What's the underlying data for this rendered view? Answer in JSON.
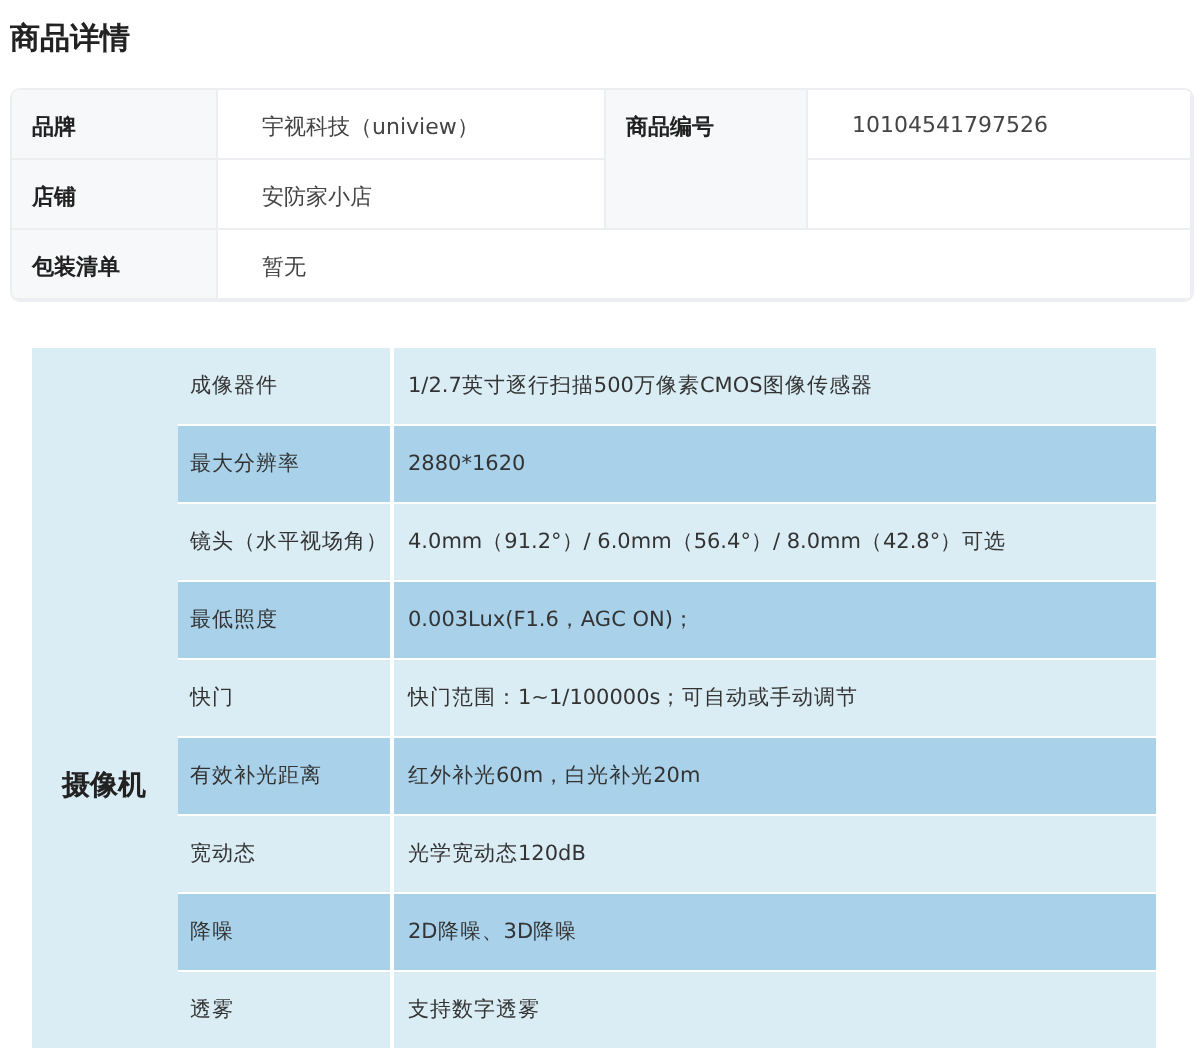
{
  "title": "商品详情",
  "info": {
    "brand_label": "品牌",
    "brand": "宇视科技（uniview）",
    "code_label": "商品编号",
    "code": "10104541797526",
    "shop_label": "店铺",
    "shop": "安防家小店",
    "package_label": "包装清单",
    "package": "暂无"
  },
  "spec": {
    "category": "摄像机",
    "rows": [
      {
        "name": "成像器件",
        "value": "1/2.7英寸逐行扫描500万像素CMOS图像传感器"
      },
      {
        "name": "最大分辨率",
        "value": "2880*1620"
      },
      {
        "name": "镜头（水平视场角）",
        "value": "4.0mm（91.2°）/ 6.0mm（56.4°）/ 8.0mm（42.8°）可选"
      },
      {
        "name": "最低照度",
        "value": "0.003Lux(F1.6，AGC ON)；"
      },
      {
        "name": "快门",
        "value": "快门范围：1~1/100000s；可自动或手动调节"
      },
      {
        "name": "有效补光距离",
        "value": "红外补光60m，白光补光20m"
      },
      {
        "name": "宽动态",
        "value": "光学宽动态120dB"
      },
      {
        "name": "降噪",
        "value": "2D降噪、3D降噪"
      },
      {
        "name": "透雾",
        "value": "支持数字透雾"
      }
    ]
  }
}
